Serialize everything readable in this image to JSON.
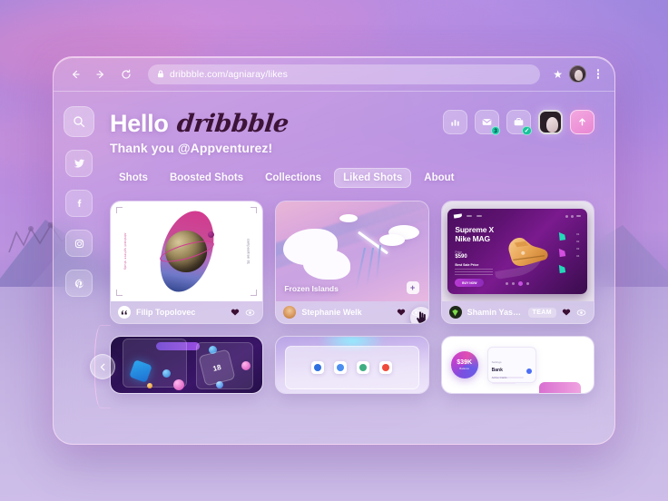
{
  "browser": {
    "url": "dribbble.com/agniaray/likes",
    "lock_icon": "lock-icon",
    "back_icon": "back-arrow-icon",
    "forward_icon": "forward-arrow-icon",
    "reload_icon": "reload-icon",
    "star_icon": "star-icon",
    "profile_icon": "profile-avatar-icon",
    "menu_icon": "kebab-menu-icon"
  },
  "rail": {
    "items": [
      {
        "name": "search-icon",
        "label": "Search"
      },
      {
        "name": "twitter-icon",
        "label": "Twitter"
      },
      {
        "name": "facebook-icon",
        "label": "Facebook"
      },
      {
        "name": "instagram-icon",
        "label": "Instagram"
      },
      {
        "name": "pinterest-icon",
        "label": "Pinterest"
      }
    ]
  },
  "header": {
    "greeting": "Hello",
    "brand": "dribbble",
    "subtitle": "Thank you @Appventurez!"
  },
  "actions": [
    {
      "name": "stats-button",
      "icon": "chart-bars-icon",
      "badge": ""
    },
    {
      "name": "messages-button",
      "icon": "envelope-icon",
      "badge": "3"
    },
    {
      "name": "jobs-button",
      "icon": "briefcase-icon",
      "badge": "✓"
    },
    {
      "name": "account-avatar-button",
      "icon": "avatar-icon",
      "badge": ""
    },
    {
      "name": "upload-shot-button",
      "icon": "upload-arrow-icon",
      "badge": ""
    }
  ],
  "tabs": [
    {
      "label": "Shots",
      "active": false
    },
    {
      "label": "Boosted Shots",
      "active": false
    },
    {
      "label": "Collections",
      "active": false
    },
    {
      "label": "Liked Shots",
      "active": true
    },
    {
      "label": "About",
      "active": false
    }
  ],
  "shots": [
    {
      "author": "Filip Topolovec",
      "title": "",
      "team": "",
      "like_icon": "heart-icon",
      "view_icon": "eye-icon",
      "art": {
        "side_text_left": "abstract sphere study",
        "side_text_right": "composition 01"
      }
    },
    {
      "author": "Stephanie Welk",
      "title": "Frozen Islands",
      "team": "",
      "like_icon": "heart-icon",
      "view_icon": "eye-icon",
      "save_icon": "plus-save-icon",
      "cursor_icon": "hand-cursor-icon"
    },
    {
      "author": "Shamin Yassar",
      "title": "Supreme X Nike MAG",
      "team": "TEAM",
      "like_icon": "heart-icon",
      "view_icon": "eye-icon",
      "art": {
        "headline_line1": "Supreme X",
        "headline_line2": "Nike MAG",
        "price_label": "Price",
        "price": "$590",
        "sub": "Best Sale Price",
        "cta": "BUY NOW",
        "slider_numbers": [
          "01",
          "02",
          "03",
          "04"
        ]
      }
    }
  ],
  "shots_bottom": [
    {
      "name": "shot-3d-glass-ui",
      "card_number": "18"
    },
    {
      "name": "shot-app-icons",
      "apps": [
        "clock-icon",
        "globe-icon",
        "person-icon",
        "star-icon"
      ]
    },
    {
      "name": "shot-finance-dashboard",
      "orb_value": "$39K",
      "orb_label": "Balance",
      "panel_title_small": "Settings",
      "panel_title": "Bank",
      "panel_footer": "Active Cards"
    }
  ],
  "collapse": {
    "name": "collapse-sidebar-button",
    "icon": "chevron-left-icon"
  },
  "colors": {
    "accent_pink": "#e987d3",
    "badge_teal": "#1fc8a8",
    "brand_dark": "#3d1438"
  }
}
